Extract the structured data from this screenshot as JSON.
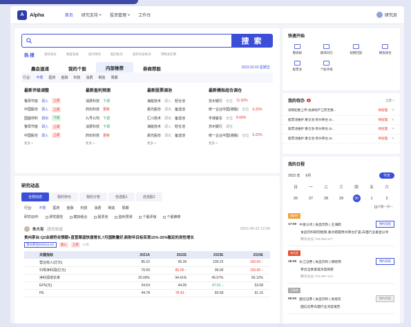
{
  "app": {
    "brand": "Alpha",
    "logo": "A",
    "user": "研究员"
  },
  "nav": {
    "items": [
      "首页",
      "研究支持 ˅",
      "投资管理 ˅",
      "工作台"
    ]
  },
  "search": {
    "placeholder": "",
    "button": "搜 索"
  },
  "hot": {
    "label": "热 搜",
    "items": [
      "金科股份",
      "隆盛发展",
      "盈利预测",
      "医药板块",
      "金科科技板块",
      "策略会纪要"
    ]
  },
  "board_tabs": {
    "items": [
      "晨会速递",
      "我的个股",
      "内部推荐",
      "券商荐股"
    ],
    "active": 2,
    "date": "2023.02.03 星期五"
  },
  "filter1": {
    "label": "行业:",
    "items": [
      "不限",
      "医药",
      "金融",
      "科技",
      "消费",
      "制造",
      "周期"
    ]
  },
  "columns": [
    {
      "title": "最新评级调整",
      "rows": [
        {
          "a": "鲁阳节能",
          "b": "调入",
          "c": "上调",
          "cc": "red"
        },
        {
          "a": "中国股份",
          "b": "调入",
          "c": "上调",
          "cc": "red"
        },
        {
          "a": "国盛材料",
          "b": "调出",
          "c": "下调",
          "cc": "green"
        },
        {
          "a": "鲁阳节能",
          "b": "调入",
          "c": "上调",
          "cc": "red"
        },
        {
          "a": "中国股份",
          "b": "调入",
          "c": "上调",
          "cc": "red"
        }
      ]
    },
    {
      "title": "最新盈利预测",
      "rows": [
        {
          "a": "消费科技",
          "b": "下调",
          "bc": "green"
        },
        {
          "a": "药石科技",
          "b": "更新",
          "bc": "red"
        },
        {
          "a": "九号公司",
          "b": "下调",
          "bc": "green"
        },
        {
          "a": "消费科技",
          "b": "下调",
          "bc": "green"
        },
        {
          "a": "药石科技",
          "b": "更新",
          "bc": "red"
        }
      ]
    },
    {
      "title": "最新股票调池",
      "rows": [
        {
          "a": "海能技术",
          "b": "调入",
          "c": "轻仓池"
        },
        {
          "a": "晨光股份",
          "b": "调出",
          "c": "备选池"
        },
        {
          "a": "汇川技术",
          "b": "调出",
          "c": "备选池"
        },
        {
          "a": "海能技术",
          "b": "调入",
          "c": "轻仓池"
        },
        {
          "a": "晨光股份",
          "b": "调出",
          "c": "备选池"
        }
      ]
    },
    {
      "title": "最新模拟组合调仓",
      "rows": [
        {
          "a": "苏州银行",
          "b": "仓位",
          "c": "11.92%"
        },
        {
          "a": "统一企业中国(港股)",
          "b": "仓位",
          "c": "5.22%"
        },
        {
          "a": "宇通客车",
          "b": "仓位",
          "c": "8.60%"
        },
        {
          "a": "苏州银行",
          "b": "调仓",
          "c": ""
        },
        {
          "a": "统一企业中国(港股)",
          "b": "仓位",
          "c": "5.22%"
        }
      ]
    }
  ],
  "more": "更多 >",
  "research": {
    "title": "研究动态",
    "tabs": [
      "全部动态",
      "我的持仓",
      "我的分管",
      "自选股1",
      "自选股2"
    ],
    "filter_label": "行业:",
    "industries": [
      "不限",
      "医药",
      "金融",
      "科技",
      "消费",
      "制造",
      "周期"
    ],
    "action_label": "研究动作:",
    "actions": [
      "研究报告",
      "模拟组合",
      "股票池",
      "盈利预测",
      "个股评级",
      "个股推荐"
    ]
  },
  "post": {
    "author": "朱大有",
    "role": "|夜安新盘",
    "date": "2022-06-22 12:09",
    "title": "贵州茅台:Q2业绩符合预期+直营渠道快速增长,7月国数量好,新财年目标实现15%-20%稳定的良性增长",
    "code": "贵州茅台600519.SH",
    "tags": [
      "调入",
      "上调"
    ],
    "views": "17页",
    "table": {
      "headers": [
        "关键指标",
        "2021A",
        "2022E",
        "2023E",
        "2024E"
      ],
      "rows": [
        [
          "营业收入(亿元)",
          "85.22",
          "95.39",
          "109.22",
          "150.00 ↑"
        ],
        [
          "归母净利润(亿元)",
          "70.00",
          "85.00 ↑",
          "90.00",
          "120.00 ↑"
        ],
        [
          "净利润增长率",
          "20.09%",
          "34.41%",
          "45.07%",
          "56.12%"
        ],
        [
          "EPS(元)",
          "34.54",
          "44.05",
          "47.01 ↓",
          "53.08"
        ],
        [
          "PE",
          "44.78",
          "78.43 ↑",
          "83.69",
          "91.15"
        ]
      ]
    }
  },
  "quick": {
    "title": "快速开始",
    "items": [
      "看研报",
      "路演日历",
      "视频回放",
      "模拟组合",
      "股票池",
      "个股评级"
    ]
  },
  "todo": {
    "title": "我的待办",
    "badge": "5",
    "more": "全部 >",
    "items": [
      {
        "t": "调研纪要上传:龙湖地产江苏无锡...",
        "s": "待处理"
      },
      {
        "t": "股票池维护:重仓池-贵州茅台 (6...",
        "s": "待处理"
      },
      {
        "t": "股票池维护:重仓池-贵州茅台 (6...",
        "s": "待处理"
      },
      {
        "t": "股票池维护:重仓池-贵州茅台 (6...",
        "s": "待处理"
      }
    ]
  },
  "calendar": {
    "title": "我的日程",
    "year": "2022 年",
    "month": "6月",
    "today": "今天",
    "weekdays": [
      "日",
      "一",
      "二",
      "三",
      "四",
      "五",
      "六"
    ],
    "days": [
      "26",
      "27",
      "28",
      "29",
      "30",
      "1",
      "2"
    ],
    "selected": 4,
    "only_label": "只看一对一",
    "events": [
      {
        "tag": "调研中",
        "tagc": "#f0a23a",
        "time": "17:00",
        "org": "中金公司 | 食品饮料 | 王海鸥",
        "title": "食品饮料研究框架,重点把握贵州茅台扩容,白酒行业基金分享",
        "btn": "预约日程",
        "meeting": "腾讯会议  700 999 877",
        "bc": ""
      },
      {
        "tag": "电话会",
        "tagc": "#e2502f",
        "time": "18:00",
        "org": "长江证券 | 食品饮料 | 杨晓燕",
        "title": "茅台当季渠道深度探索",
        "btn": "预约日程",
        "meeting": "腾讯会议  700 897 612",
        "bc": "",
        "hot": "TOP"
      },
      {
        "tag": "已结束",
        "tagc": "#aaa",
        "time": "09:00",
        "org": "国信证券 | 食品饮料 | 张旭东",
        "title": "国信证券白酒行业深度报告",
        "btn": "预约日程",
        "meeting": "",
        "bc": "gray"
      }
    ]
  }
}
